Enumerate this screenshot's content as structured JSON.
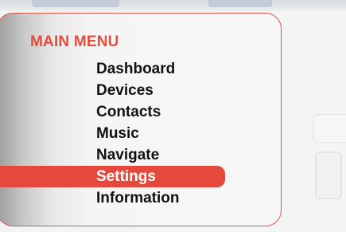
{
  "menu": {
    "title": "MAIN MENU",
    "selected_index": 5,
    "items": [
      {
        "label": "Dashboard"
      },
      {
        "label": "Devices"
      },
      {
        "label": "Contacts"
      },
      {
        "label": "Music"
      },
      {
        "label": "Navigate"
      },
      {
        "label": "Settings"
      },
      {
        "label": "Information"
      }
    ]
  },
  "colors": {
    "accent": "#e5493b",
    "text": "#111111",
    "panel_border": "#e0564a"
  }
}
